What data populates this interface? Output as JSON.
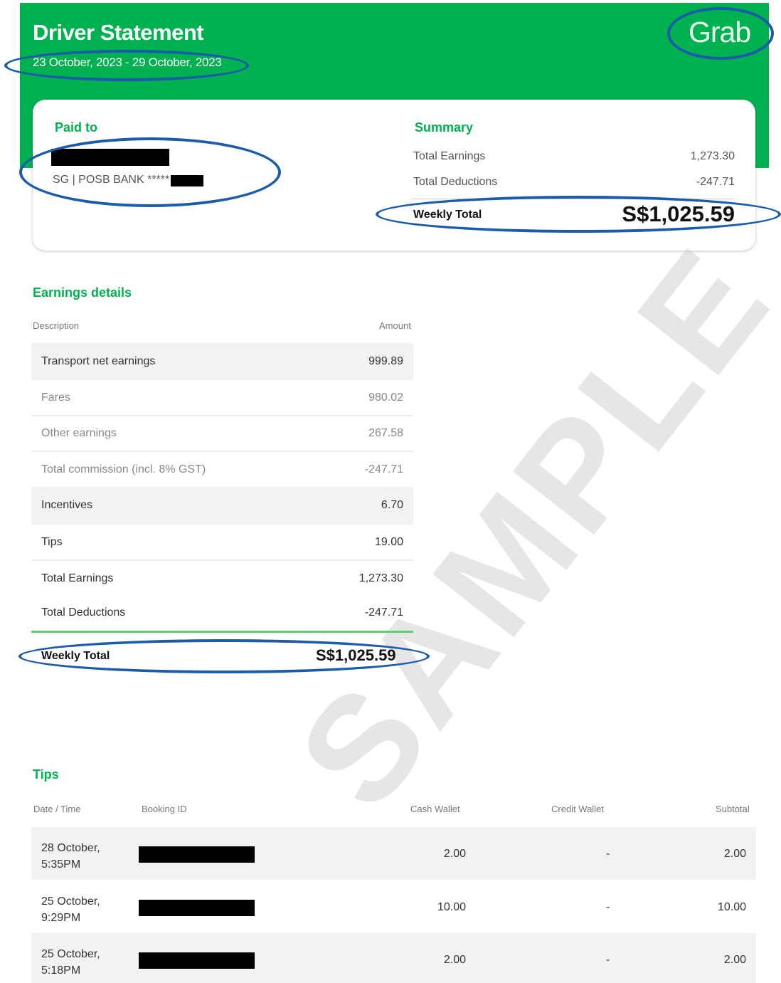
{
  "header": {
    "title": "Driver Statement",
    "date_range": "23 October, 2023 - 29 October, 2023",
    "logo": "Grab"
  },
  "paid_to": {
    "label": "Paid to",
    "bank": "SG | POSB BANK *****"
  },
  "summary": {
    "label": "Summary",
    "total_earnings_label": "Total Earnings",
    "total_earnings": "1,273.30",
    "total_deductions_label": "Total Deductions",
    "total_deductions": "-247.71",
    "weekly_total_label": "Weekly Total",
    "weekly_total": "S$1,025.59"
  },
  "earnings": {
    "title": "Earnings details",
    "col_description": "Description",
    "col_amount": "Amount",
    "rows": [
      {
        "label": "Transport net earnings",
        "amount": "999.89"
      },
      {
        "label": "Fares",
        "amount": "980.02"
      },
      {
        "label": "Other earnings",
        "amount": "267.58"
      },
      {
        "label": "Total commission (incl. 8% GST)",
        "amount": "-247.71"
      },
      {
        "label": "Incentives",
        "amount": "6.70"
      },
      {
        "label": "Tips",
        "amount": "19.00"
      },
      {
        "label": "Total Earnings",
        "amount": "1,273.30"
      },
      {
        "label": "Total Deductions",
        "amount": "-247.71"
      }
    ],
    "weekly_total_label": "Weekly Total",
    "weekly_total": "S$1,025.59"
  },
  "watermark": "SAMPLE",
  "tips": {
    "title": "Tips",
    "col_date": "Date / Time",
    "col_booking": "Booking ID",
    "col_cash": "Cash Wallet",
    "col_credit": "Credit Wallet",
    "col_subtotal": "Subtotal",
    "rows": [
      {
        "date": "28 October,",
        "time": "5:35PM",
        "cash": "2.00",
        "credit": "-",
        "subtotal": "2.00"
      },
      {
        "date": "25 October,",
        "time": "9:29PM",
        "cash": "10.00",
        "credit": "-",
        "subtotal": "10.00"
      },
      {
        "date": "25 October,",
        "time": "5:18PM",
        "cash": "2.00",
        "credit": "-",
        "subtotal": "2.00"
      }
    ]
  },
  "colors": {
    "brand_green": "#00b14f",
    "annotation_blue": "#1a5bab"
  }
}
